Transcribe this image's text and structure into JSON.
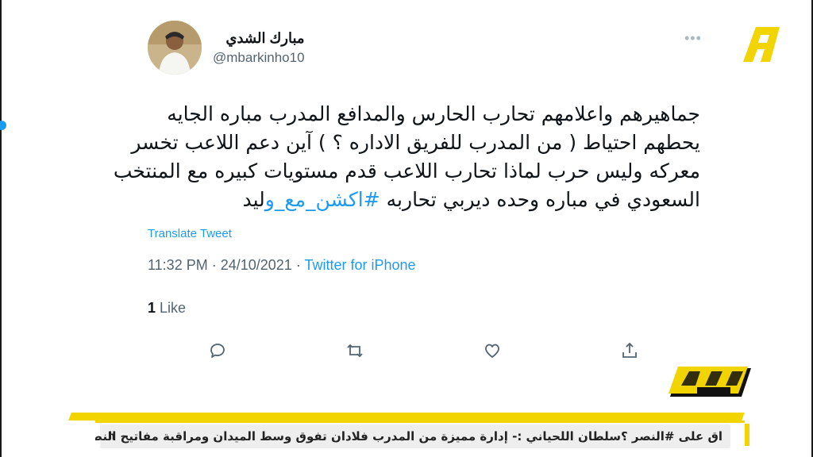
{
  "tweet": {
    "author_name": "مبارك الشدي",
    "author_handle": "@mbarkinho10",
    "more_icon": "more-horizontal-icon",
    "body_lines": [
      "جماهيرهم  واعلامهم  تحارب الحارس والمدافع  المدرب مباره الجايه",
      "يحطهم احتياط ( من المدرب للفريق الاداره ؟ ) آين دعم اللاعب  تخسر",
      "معركه وليس حرب لماذا تحارب اللاعب قدم مستويات كبيره مع المنتخب"
    ],
    "body_last_line": "السعودي في مباره وحده ديربي تحاربه  ",
    "hashtag_blue": "#اكشن_مع_و",
    "hashtag_dark": "ليد",
    "translate_label": "Translate Tweet",
    "time": "11:32 PM",
    "date": "24/10/2021",
    "source": "Twitter for iPhone",
    "separator": " · ",
    "likes_count": "1",
    "likes_label": "Like"
  },
  "actions": {
    "reply_icon": "reply-icon",
    "retweet_icon": "retweet-icon",
    "like_icon": "heart-icon",
    "share_icon": "share-icon"
  },
  "ticker": {
    "text": "اق على #النصر ؟سلطان اللحياني :- إدارة مميزة من المدرب فلادان     تفوق وسط الميدان ومراقبة مفاتيح النصر",
    "edge_letter": "h"
  },
  "colors": {
    "accent": "#1d9bf0",
    "brand_yellow": "#f1d400",
    "text": "#0f1419",
    "muted": "#536471"
  }
}
